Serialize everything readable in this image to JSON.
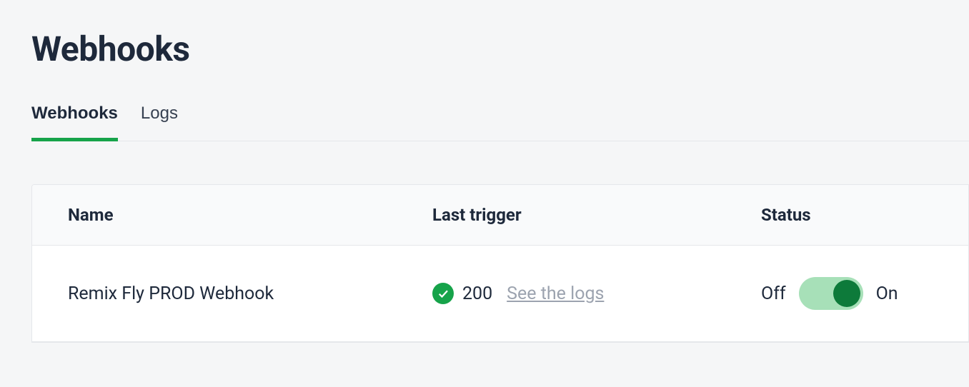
{
  "page": {
    "title": "Webhooks"
  },
  "tabs": [
    {
      "label": "Webhooks",
      "active": true
    },
    {
      "label": "Logs",
      "active": false
    }
  ],
  "table": {
    "headers": {
      "name": "Name",
      "last_trigger": "Last trigger",
      "status": "Status"
    },
    "rows": [
      {
        "name": "Remix Fly PROD Webhook",
        "status_code": "200",
        "logs_link": "See the logs",
        "toggle": {
          "off_label": "Off",
          "on_label": "On",
          "state": "on"
        }
      }
    ]
  }
}
